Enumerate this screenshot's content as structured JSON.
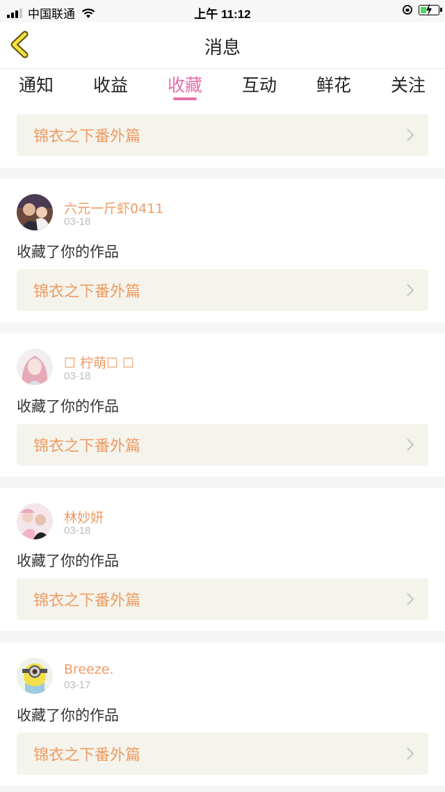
{
  "status_bar": {
    "carrier": "中国联通",
    "time": "上午 11:12"
  },
  "nav": {
    "title": "消息"
  },
  "tabs": [
    {
      "label": "通知"
    },
    {
      "label": "收益"
    },
    {
      "label": "收藏",
      "active": true
    },
    {
      "label": "互动"
    },
    {
      "label": "鲜花"
    },
    {
      "label": "关注"
    }
  ],
  "top_card": {
    "title": "锦衣之下番外篇"
  },
  "notifications": [
    {
      "username": "六元一斤虾0411",
      "date": "03-18",
      "action": "收藏了你的作品",
      "work_title": "锦衣之下番外篇"
    },
    {
      "username": "☐  柠萌☐ ☐",
      "date": "03-18",
      "action": "收藏了你的作品",
      "work_title": "锦衣之下番外篇"
    },
    {
      "username": "林妙妍",
      "date": "03-18",
      "action": "收藏了你的作品",
      "work_title": "锦衣之下番外篇"
    },
    {
      "username": "Breeze.",
      "date": "03-17",
      "action": "收藏了你的作品",
      "work_title": "锦衣之下番外篇"
    }
  ],
  "colors": {
    "accent": "#e76ea8",
    "username": "#ee9b63",
    "card_bg": "#f4f4ec"
  }
}
